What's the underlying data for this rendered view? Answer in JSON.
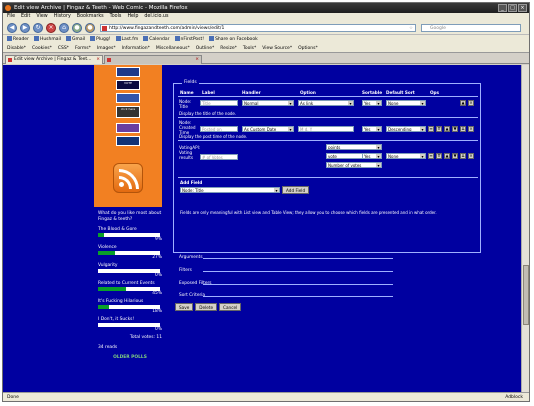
{
  "window": {
    "title": "Edit view Archive | Fingaz & Teeth - Web Comic - Mozilla Firefox"
  },
  "menu": [
    "File",
    "Edit",
    "View",
    "History",
    "Bookmarks",
    "Tools",
    "Help",
    "del.icio.us"
  ],
  "nav": {
    "url": "http://www.fingazandteeth.com/admin/views/edit/1",
    "search_placeholder": "Google"
  },
  "bookmarks": [
    "Reader",
    "Hushmail",
    "Gmail",
    "Plugg!",
    "Last.fm",
    "Calendar",
    "nFirstPost!",
    "Share on Facebook"
  ],
  "devbar": [
    "Disable*",
    "Cookies*",
    "CSS*",
    "Forms*",
    "Images*",
    "Information*",
    "Miscellaneous*",
    "Outline*",
    "Resize*",
    "Tools*",
    "View Source*",
    "Options*"
  ],
  "tabs": [
    {
      "label": "Edit view Archive | Fingaz & Teet...",
      "active": true
    },
    {
      "label": "",
      "active": false
    }
  ],
  "sidebar": {
    "banners": [
      "",
      "VOTE",
      "",
      "click here",
      "",
      ""
    ],
    "poll": {
      "question": "What do you like most about Fingaz & teeth?",
      "options": [
        {
          "label": "The Blood & Gore",
          "pct": "9%",
          "value": 9
        },
        {
          "label": "Violence",
          "pct": "27%",
          "value": 27
        },
        {
          "label": "Vulgarity",
          "pct": "0%",
          "value": 0
        },
        {
          "label": "Related to Current Events",
          "pct": "45%",
          "value": 45
        },
        {
          "label": "It's Fucking Hilarious",
          "pct": "18%",
          "value": 18
        },
        {
          "label": "I Don't, it Sucks!",
          "pct": "0%",
          "value": 0
        }
      ],
      "total": "Total votes: 11",
      "reads": "34 reads",
      "older": "OLDER POLLS"
    }
  },
  "fields": {
    "legend": "Fields",
    "headers": {
      "name": "Name",
      "label": "Label",
      "handler": "Handler",
      "option": "Option",
      "sortable": "Sortable",
      "default_sort": "Default Sort",
      "ops": "Ops"
    },
    "rows": [
      {
        "name": "Node: Title",
        "label_placeholder": "Title",
        "handler": "Normal",
        "option": "As link",
        "sortable": "Yes",
        "default_sort": "None",
        "help": "Display the title of the node."
      },
      {
        "name": "Node: Created Time",
        "label_placeholder": "Posted on",
        "handler": "As Custom Date",
        "option_placeholder": "M d, Y",
        "sortable": "Yes",
        "default_sort": "Descending",
        "help": "Display the post time of the node."
      },
      {
        "name": "VotingAPI: Voting results",
        "label_placeholder": "# of Votes",
        "option1": "points",
        "option2": "vote",
        "option3": "Number of votes",
        "sortable": "Yes",
        "default_sort": "None"
      }
    ],
    "add_field": {
      "title": "Add Field",
      "selected": "Node: Title",
      "button": "Add Field"
    },
    "note": "Fields are only meaningful with List view and Table View; they allow you to choose which fields are presented and in what order."
  },
  "collapsed": [
    "Arguments",
    "Filters",
    "Exposed Filters",
    "Sort Criteria"
  ],
  "buttons": {
    "save": "Save",
    "delete": "Delete",
    "cancel": "Cancel"
  },
  "status": {
    "left": "Done",
    "right": "Adblock"
  }
}
